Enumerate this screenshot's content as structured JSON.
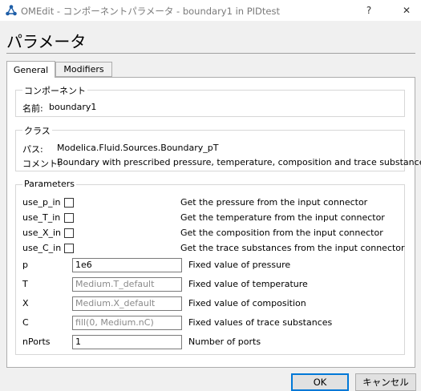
{
  "window": {
    "title": "OMEdit - コンポーネントパラメータ - boundary1 in PIDtest",
    "help_glyph": "?",
    "close_glyph": "✕"
  },
  "heading": "パラメータ",
  "tabs": [
    {
      "label": "General",
      "active": true
    },
    {
      "label": "Modifiers",
      "active": false
    }
  ],
  "component": {
    "title": "コンポーネント",
    "name_label": "名前:",
    "name_value": "boundary1"
  },
  "class_group": {
    "title": "クラス",
    "path_label": "パス:",
    "path_value": "Modelica.Fluid.Sources.Boundary_pT",
    "comment_label": "コメント:",
    "comment_value": "Boundary with prescribed pressure, temperature, composition and trace substances"
  },
  "parameters": {
    "title": "Parameters",
    "flags": [
      {
        "name": "use_p_in",
        "checked": false,
        "description": "Get the pressure from the input connector"
      },
      {
        "name": "use_T_in",
        "checked": false,
        "description": "Get the temperature from the input connector"
      },
      {
        "name": "use_X_in",
        "checked": false,
        "description": "Get the composition from the input connector"
      },
      {
        "name": "use_C_in",
        "checked": false,
        "description": "Get the trace substances from the input connector"
      }
    ],
    "fields": [
      {
        "name": "p",
        "value": "1e6",
        "placeholder": "",
        "description": "Fixed value of pressure"
      },
      {
        "name": "T",
        "value": "",
        "placeholder": "Medium.T_default",
        "description": "Fixed value of temperature"
      },
      {
        "name": "X",
        "value": "",
        "placeholder": "Medium.X_default",
        "description": "Fixed value of composition"
      },
      {
        "name": "C",
        "value": "",
        "placeholder": "fill(0, Medium.nC)",
        "description": "Fixed values of trace substances"
      },
      {
        "name": "nPorts",
        "value": "1",
        "placeholder": "",
        "description": "Number of ports"
      }
    ]
  },
  "buttons": {
    "ok": "OK",
    "cancel": "キャンセル"
  },
  "colors": {
    "accent": "#0078d7",
    "app_icon": "#1f5fa8"
  }
}
